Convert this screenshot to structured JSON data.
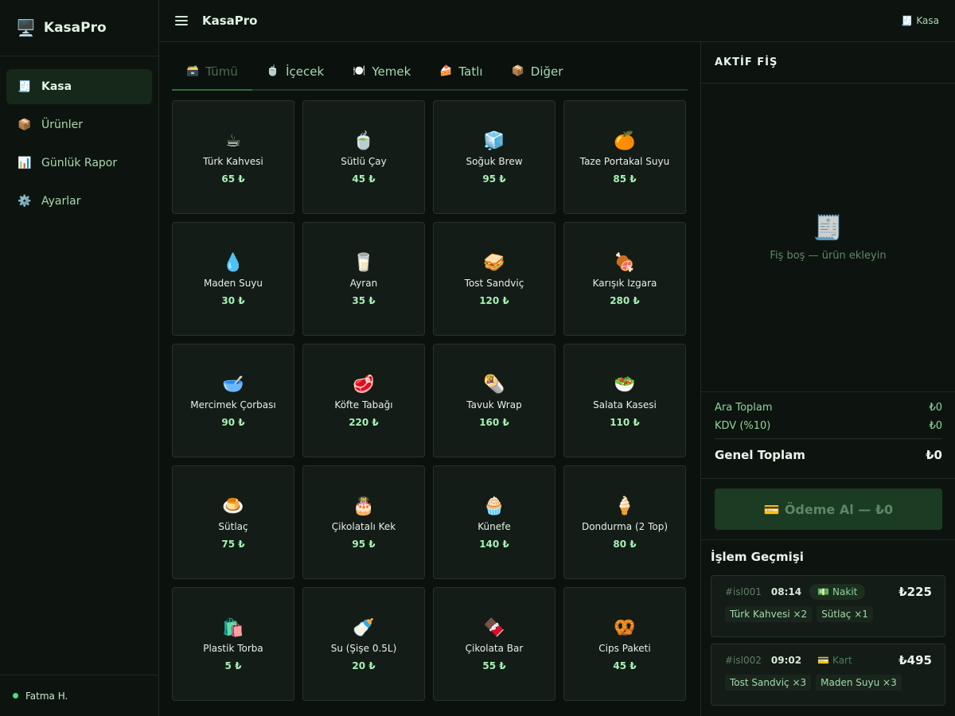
{
  "brand": {
    "icon": "🖥️",
    "name": "KasaPro"
  },
  "nav": [
    {
      "icon": "🧾",
      "label": "Kasa",
      "name": "kasa",
      "active": true
    },
    {
      "icon": "📦",
      "label": "Ürünler",
      "name": "urunler"
    },
    {
      "icon": "📊",
      "label": "Günlük Rapor",
      "name": "gunluk-rapor"
    },
    {
      "icon": "⚙️",
      "label": "Ayarlar",
      "name": "ayarlar"
    }
  ],
  "user": {
    "name": "Fatma H."
  },
  "topbar": {
    "title": "KasaPro",
    "right_icon": "🧾",
    "right_label": "Kasa"
  },
  "tabs": [
    {
      "icon": "🗃️",
      "label": "Tümü",
      "name": "tumu",
      "active": true
    },
    {
      "icon": "🍵",
      "label": "İçecek",
      "name": "icecek"
    },
    {
      "icon": "🍽️",
      "label": "Yemek",
      "name": "yemek"
    },
    {
      "icon": "🍰",
      "label": "Tatlı",
      "name": "tatli"
    },
    {
      "icon": "📦",
      "label": "Diğer",
      "name": "diger"
    }
  ],
  "products": [
    {
      "emoji": "☕",
      "name": "Türk Kahvesi",
      "price": "65 ₺"
    },
    {
      "emoji": "🍵",
      "name": "Sütlü Çay",
      "price": "45 ₺"
    },
    {
      "emoji": "🧊",
      "name": "Soğuk Brew",
      "price": "95 ₺"
    },
    {
      "emoji": "🍊",
      "name": "Taze Portakal Suyu",
      "price": "85 ₺"
    },
    {
      "emoji": "💧",
      "name": "Maden Suyu",
      "price": "30 ₺"
    },
    {
      "emoji": "🥛",
      "name": "Ayran",
      "price": "35 ₺"
    },
    {
      "emoji": "🥪",
      "name": "Tost Sandviç",
      "price": "120 ₺"
    },
    {
      "emoji": "🍖",
      "name": "Karışık Izgara",
      "price": "280 ₺"
    },
    {
      "emoji": "🥣",
      "name": "Mercimek Çorbası",
      "price": "90 ₺"
    },
    {
      "emoji": "🥩",
      "name": "Köfte Tabağı",
      "price": "220 ₺"
    },
    {
      "emoji": "🌯",
      "name": "Tavuk Wrap",
      "price": "160 ₺"
    },
    {
      "emoji": "🥗",
      "name": "Salata Kasesi",
      "price": "110 ₺"
    },
    {
      "emoji": "🍮",
      "name": "Sütlaç",
      "price": "75 ₺"
    },
    {
      "emoji": "🎂",
      "name": "Çikolatalı Kek",
      "price": "95 ₺"
    },
    {
      "emoji": "🧁",
      "name": "Künefe",
      "price": "140 ₺"
    },
    {
      "emoji": "🍦",
      "name": "Dondurma (2 Top)",
      "price": "80 ₺"
    },
    {
      "emoji": "🛍️",
      "name": "Plastik Torba",
      "price": "5 ₺"
    },
    {
      "emoji": "🍼",
      "name": "Su (Şişe 0.5L)",
      "price": "20 ₺"
    },
    {
      "emoji": "🍫",
      "name": "Çikolata Bar",
      "price": "55 ₺"
    },
    {
      "emoji": "🥨",
      "name": "Cips Paketi",
      "price": "45 ₺"
    }
  ],
  "receipt": {
    "title": "AKTİF FİŞ",
    "empty_icon": "🧾",
    "empty_text": "Fiş boş — ürün ekleyin",
    "subtotal_label": "Ara Toplam",
    "subtotal_value": "₺0",
    "tax_label": "KDV (%10)",
    "tax_value": "₺0",
    "grand_label": "Genel Toplam",
    "grand_value": "₺0",
    "pay_icon": "💳",
    "pay_label": "Ödeme Al — ₺0"
  },
  "history": {
    "title": "İşlem Geçmişi",
    "items": [
      {
        "id": "#isl001",
        "time": "08:14",
        "method_icon": "💵",
        "method": "Nakit",
        "total": "₺225",
        "items": [
          "Türk Kahvesi ×2",
          "Sütlaç ×1"
        ],
        "muted": false
      },
      {
        "id": "#isl002",
        "time": "09:02",
        "method_icon": "💳",
        "method": "Kart",
        "total": "₺495",
        "items": [
          "Tost Sandviç ×3",
          "Maden Suyu ×3"
        ],
        "muted": true
      }
    ]
  }
}
